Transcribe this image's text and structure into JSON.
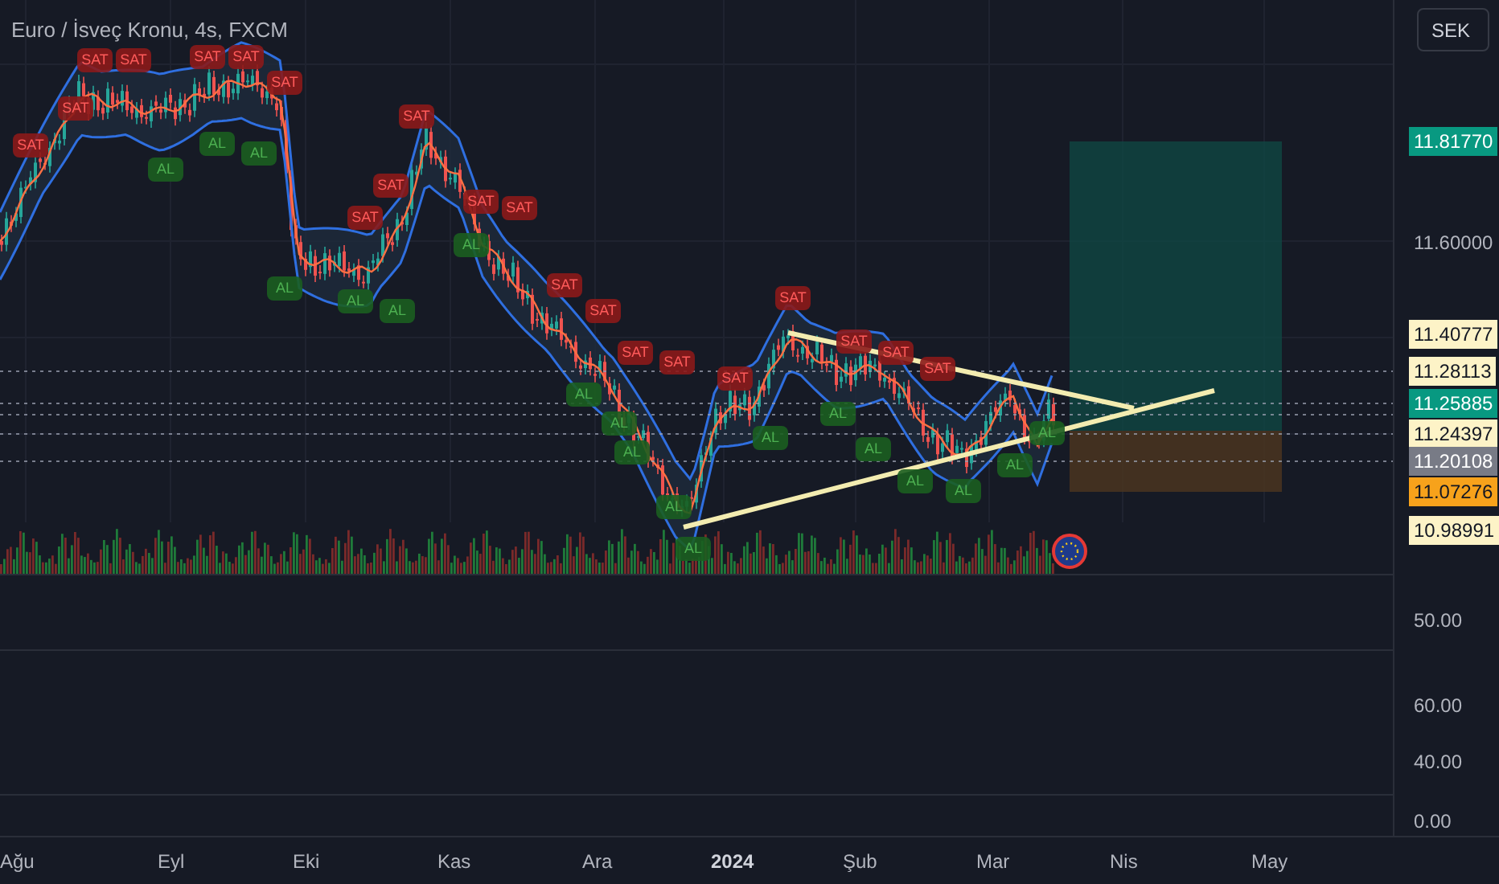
{
  "title": "Euro / İsveç Kronu, 4s, FXCM",
  "currency_button": "SEK",
  "price_scale": [
    {
      "kind": "tag",
      "text": "11.81770",
      "color": "#089981"
    },
    {
      "kind": "tick",
      "text": "11.60000"
    },
    {
      "kind": "tag",
      "text": "11.40777",
      "color": "#fdf3c7"
    },
    {
      "kind": "tag",
      "text": "11.28113",
      "color": "#fdf3c7"
    },
    {
      "kind": "tag",
      "text": "11.25885",
      "color": "#089981"
    },
    {
      "kind": "tag",
      "text": "11.24397",
      "color": "#fdf3c7"
    },
    {
      "kind": "tag",
      "text": "11.20108",
      "color": "#787b86"
    },
    {
      "kind": "tag",
      "text": "11.07276",
      "color": "#f7a21b"
    },
    {
      "kind": "tag",
      "text": "10.98991",
      "color": "#fdf3c7"
    }
  ],
  "pane_scales": [
    {
      "text": "50.00"
    },
    {
      "text": "60.00"
    },
    {
      "text": "40.00"
    },
    {
      "text": "0.00"
    }
  ],
  "time_axis": [
    {
      "kind": "month",
      "text": "Ağu"
    },
    {
      "kind": "month",
      "text": "Eyl"
    },
    {
      "kind": "month",
      "text": "Eki"
    },
    {
      "kind": "month",
      "text": "Kas"
    },
    {
      "kind": "month",
      "text": "Ara"
    },
    {
      "kind": "year",
      "text": "2024"
    },
    {
      "kind": "month",
      "text": "Şub"
    },
    {
      "kind": "month",
      "text": "Mar"
    },
    {
      "kind": "month",
      "text": "Nis"
    },
    {
      "kind": "month",
      "text": "May"
    }
  ],
  "signals": [
    {
      "kind": "sell",
      "text": "SAT"
    },
    {
      "kind": "sell",
      "text": "SAT"
    },
    {
      "kind": "sell",
      "text": "SAT"
    },
    {
      "kind": "sell",
      "text": "SAT"
    },
    {
      "kind": "sell",
      "text": "SAT"
    },
    {
      "kind": "sell",
      "text": "SAT"
    },
    {
      "kind": "sell",
      "text": "SAT"
    },
    {
      "kind": "sell",
      "text": "SAT"
    },
    {
      "kind": "sell",
      "text": "SAT"
    },
    {
      "kind": "sell",
      "text": "SAT"
    },
    {
      "kind": "sell",
      "text": "SAT"
    },
    {
      "kind": "sell",
      "text": "SAT"
    },
    {
      "kind": "sell",
      "text": "SAT"
    },
    {
      "kind": "sell",
      "text": "SAT"
    },
    {
      "kind": "sell",
      "text": "SAT"
    },
    {
      "kind": "sell",
      "text": "SAT"
    },
    {
      "kind": "sell",
      "text": "SAT"
    },
    {
      "kind": "sell",
      "text": "SAT"
    },
    {
      "kind": "sell",
      "text": "SAT"
    },
    {
      "kind": "sell",
      "text": "SAT"
    },
    {
      "kind": "sell",
      "text": "SAT"
    },
    {
      "kind": "buy",
      "text": "AL"
    },
    {
      "kind": "buy",
      "text": "AL"
    },
    {
      "kind": "buy",
      "text": "AL"
    },
    {
      "kind": "buy",
      "text": "AL"
    },
    {
      "kind": "buy",
      "text": "AL"
    },
    {
      "kind": "buy",
      "text": "AL"
    },
    {
      "kind": "buy",
      "text": "AL"
    },
    {
      "kind": "buy",
      "text": "AL"
    },
    {
      "kind": "buy",
      "text": "AL"
    },
    {
      "kind": "buy",
      "text": "AL"
    },
    {
      "kind": "buy",
      "text": "AL"
    },
    {
      "kind": "buy",
      "text": "AL"
    },
    {
      "kind": "buy",
      "text": "AL"
    },
    {
      "kind": "buy",
      "text": "AL"
    },
    {
      "kind": "buy",
      "text": "AL"
    },
    {
      "kind": "buy",
      "text": "AL"
    },
    {
      "kind": "buy",
      "text": "AL"
    },
    {
      "kind": "buy",
      "text": "AL"
    },
    {
      "kind": "buy",
      "text": "AL"
    }
  ]
}
